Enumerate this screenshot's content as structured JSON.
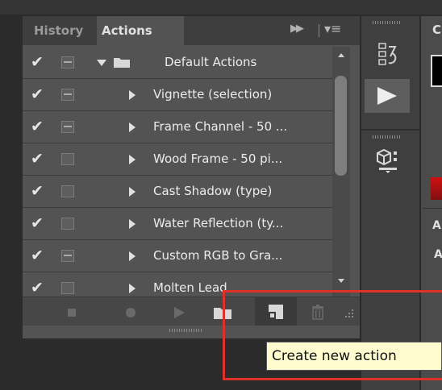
{
  "tabs": [
    {
      "label": "History"
    },
    {
      "label": "Actions"
    }
  ],
  "panel": {
    "more_icon": "double-chevron-right-icon",
    "menu_icon": "panel-menu-icon"
  },
  "actions": [
    {
      "label": "Default Actions",
      "checked": true,
      "dialog": true,
      "expanded": true,
      "is_set": true
    },
    {
      "label": "Vignette (selection)",
      "checked": true,
      "dialog": true
    },
    {
      "label": "Frame Channel - 50 ...",
      "checked": true,
      "dialog": true
    },
    {
      "label": "Wood Frame - 50 pi...",
      "checked": true,
      "dialog": false
    },
    {
      "label": "Cast Shadow (type)",
      "checked": true,
      "dialog": false
    },
    {
      "label": "Water Reflection (ty...",
      "checked": true,
      "dialog": false
    },
    {
      "label": "Custom RGB to Gra...",
      "checked": true,
      "dialog": true
    },
    {
      "label": "Molten Lead",
      "checked": true,
      "dialog": false
    }
  ],
  "toolbar": {
    "buttons": [
      "stop-icon",
      "record-icon",
      "play-icon",
      "new-set-folder-icon",
      "new-action-icon",
      "trash-icon"
    ]
  },
  "tooltip": {
    "text": "Create new action"
  },
  "right_panel": {
    "header": "C",
    "label_a1": "A",
    "label_a2": "A"
  },
  "colors": {
    "highlight": "#e0302a",
    "tooltip_bg": "#fffdd0"
  }
}
